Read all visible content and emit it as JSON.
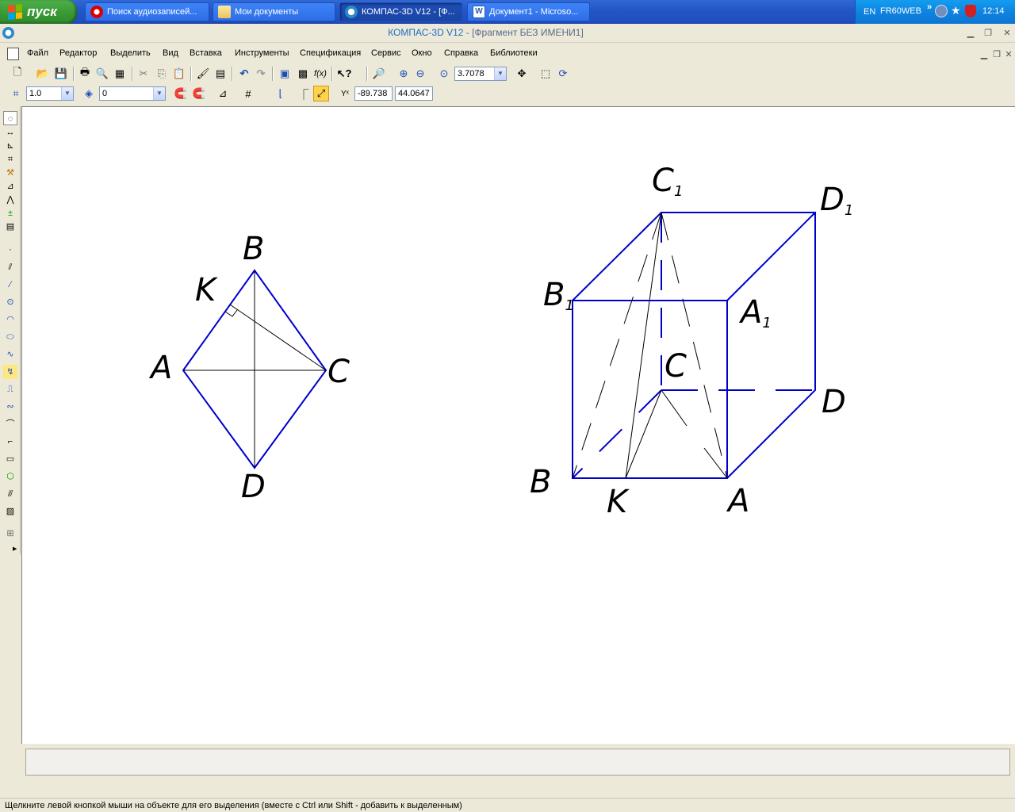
{
  "taskbar": {
    "start_label": "пуск",
    "tasks": [
      {
        "label": "Поиск аудиозаписей...",
        "icon": "opera-icon"
      },
      {
        "label": "Мои документы",
        "icon": "folder-icon"
      },
      {
        "label": "КОМПАС-3D V12 - [Ф...",
        "icon": "kompas-icon"
      },
      {
        "label": "Документ1 - Microso...",
        "icon": "word-icon"
      }
    ],
    "tray": {
      "lang": "EN",
      "user": "FR60WEB",
      "chevron": "»",
      "time": "12:14"
    }
  },
  "window": {
    "app_name": "КОМПАС-3D V12",
    "doc_title": " - [Фрагмент БЕЗ ИМЕНИ1]"
  },
  "menu": [
    "Файл",
    "Редактор",
    "Выделить",
    "Вид",
    "Вставка",
    "Инструменты",
    "Спецификация",
    "Сервис",
    "Окно",
    "Справка",
    "Библиотеки"
  ],
  "toolbar": {
    "zoom_value": "3.7078",
    "step_value": "1.0",
    "layer_value": "0",
    "coord_x": "-89.738",
    "coord_y": "44.0647"
  },
  "drawing": {
    "rhombus_labels": {
      "A": "A",
      "B": "B",
      "C": "C",
      "D": "D",
      "K": "K"
    },
    "cube_labels": {
      "A": "A",
      "B": "B",
      "C": "C",
      "D": "D",
      "K": "K",
      "A1": "A",
      "B1": "B",
      "C1": "C",
      "D1": "D",
      "sub": "1"
    },
    "colors": {
      "edge": "#0000cc",
      "construction": "#000000"
    }
  },
  "status": "Щелкните левой кнопкой мыши на объекте для его выделения (вместе с Ctrl или Shift - добавить к выделенным)"
}
